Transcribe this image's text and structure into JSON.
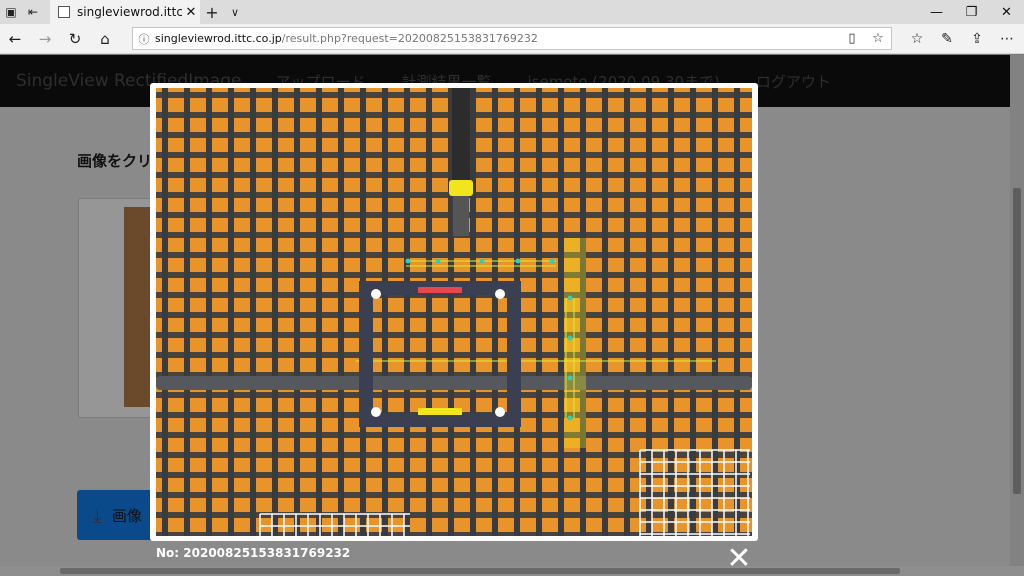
{
  "browser": {
    "tab_title": "singleviewrod.ittc.co.jp",
    "url_host": "singleviewrod.ittc.co.jp",
    "url_path": "/result.php?request=20200825153831769232"
  },
  "page": {
    "brand": "SingleView RectifiedImage",
    "menu": [
      "アップロード",
      "計測結果一覧",
      "isemoto (2020.09.30まで)",
      "ログアウト"
    ],
    "heading": "画像をクリ",
    "download_label": "画像"
  },
  "lightbox": {
    "caption": "No: 20200825153831769232",
    "close_glyph": "✕"
  },
  "colors": {
    "formwork": "#e8942a",
    "rebar": "#3a3c3f",
    "marker_red": "#e8454d",
    "marker_yellow": "#f2e51c",
    "measure_line": "#d9f030",
    "measure_point": "#2ad0c0"
  }
}
